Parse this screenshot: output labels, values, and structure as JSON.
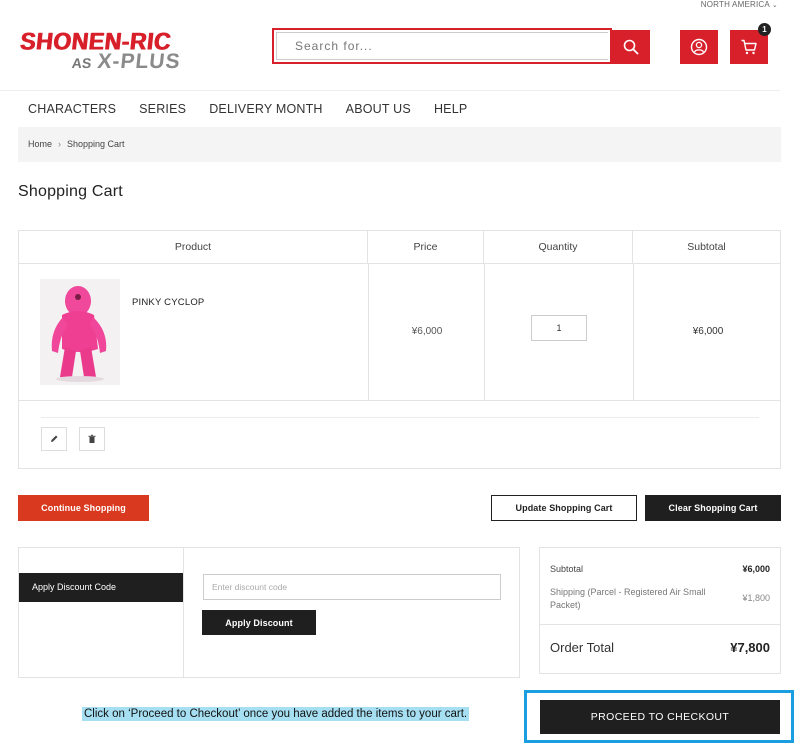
{
  "header": {
    "region": "NORTH AMERICA",
    "logo_line1": "SHONEN-RIC",
    "logo_as": "AS",
    "logo_line2": "X-PLUS",
    "search_placeholder": "Search for...",
    "cart_count": "1",
    "brand_color": "#d8202a"
  },
  "nav": {
    "items": [
      "CHARACTERS",
      "SERIES",
      "DELIVERY MONTH",
      "ABOUT US",
      "HELP"
    ]
  },
  "breadcrumb": {
    "home": "Home",
    "current": "Shopping Cart"
  },
  "page_title": "Shopping Cart",
  "cart": {
    "headers": {
      "product": "Product",
      "price": "Price",
      "quantity": "Quantity",
      "subtotal": "Subtotal"
    },
    "items": [
      {
        "name": "PINKY CYCLOP",
        "price": "¥6,000",
        "quantity": "1",
        "subtotal": "¥6,000"
      }
    ]
  },
  "actions": {
    "continue": "Continue Shopping",
    "update": "Update Shopping Cart",
    "clear": "Clear Shopping Cart"
  },
  "discount": {
    "tab_label": "Apply Discount Code",
    "placeholder": "Enter discount code",
    "apply_label": "Apply Discount"
  },
  "summary": {
    "subtotal_label": "Subtotal",
    "subtotal_value": "¥6,000",
    "shipping_label": "Shipping (Parcel - Registered Air Small Packet)",
    "shipping_value": "¥1,800",
    "total_label": "Order Total",
    "total_value": "¥7,800"
  },
  "instruction": "Click on ‘Proceed to Checkout’ once you have added the items to your cart.",
  "checkout_label": "PROCEED TO CHECKOUT",
  "colors": {
    "highlight": "#1b9ee0",
    "hint_bg": "#a6dff2",
    "continue_btn": "#d9391e"
  }
}
